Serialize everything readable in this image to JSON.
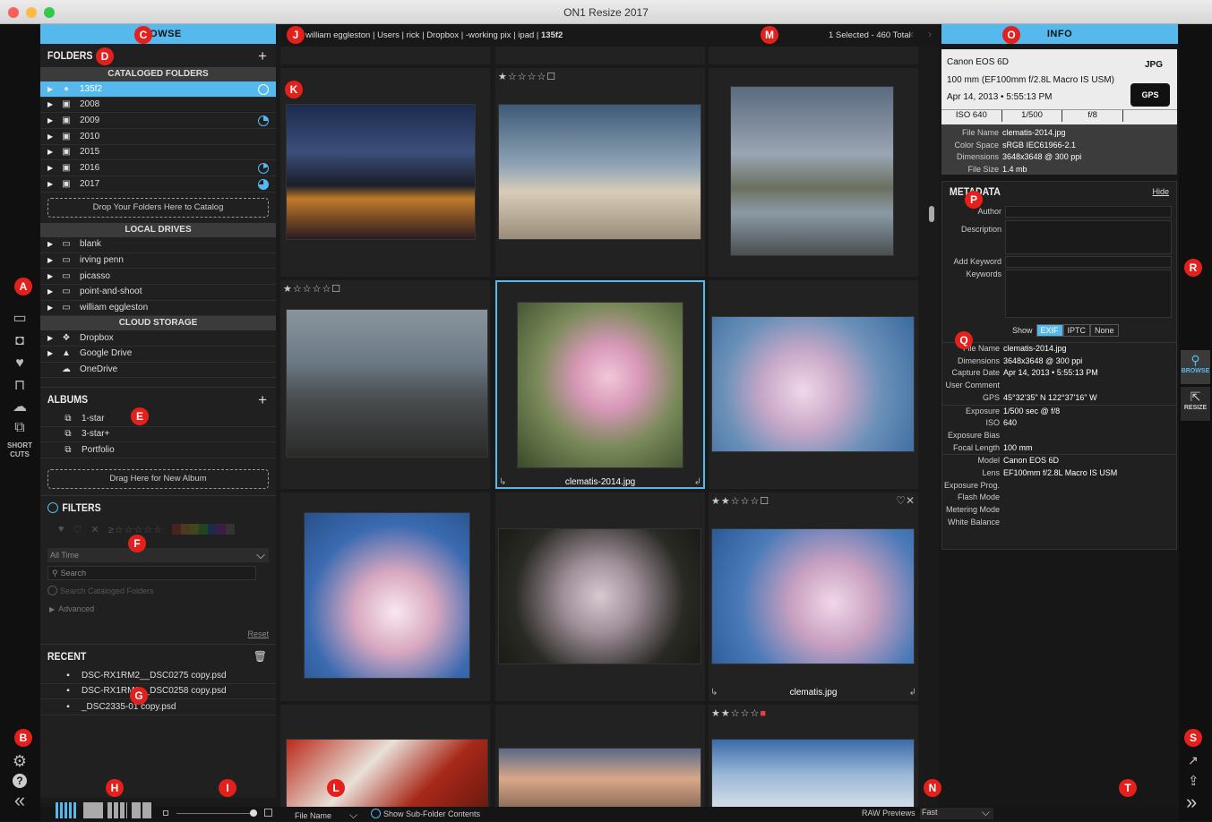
{
  "window": {
    "title": "ON1 Resize 2017"
  },
  "markers": [
    "A",
    "B",
    "C",
    "D",
    "E",
    "F",
    "G",
    "H",
    "I",
    "J",
    "K",
    "L",
    "M",
    "N",
    "O",
    "P",
    "Q",
    "R",
    "S",
    "T"
  ],
  "left_rail": {
    "shortcuts_label": "SHORT CUTS"
  },
  "browse": {
    "header": "BROWSE"
  },
  "folders": {
    "title": "FOLDERS",
    "cataloged_header": "CATALOGED FOLDERS",
    "cataloged": [
      "135f2",
      "2008",
      "2009",
      "2010",
      "2015",
      "2016",
      "2017"
    ],
    "drop_label": "Drop Your Folders Here to Catalog",
    "local_header": "LOCAL DRIVES",
    "local": [
      "blank",
      "irving penn",
      "picasso",
      "point-and-shoot",
      "william eggleston"
    ],
    "cloud_header": "CLOUD STORAGE",
    "cloud": [
      "Dropbox",
      "Google Drive",
      "OneDrive"
    ]
  },
  "albums": {
    "title": "ALBUMS",
    "items": [
      "1-star",
      "3-star+",
      "Portfolio"
    ],
    "drop_label": "Drag Here for New Album"
  },
  "filters": {
    "title": "FILTERS",
    "time": "All Time",
    "search_placeholder": "Search",
    "search_cataloged": "Search Cataloged Folders",
    "advanced": "Advanced",
    "reset": "Reset"
  },
  "recent": {
    "title": "RECENT",
    "items": [
      "DSC-RX1RM2__DSC0275 copy.psd",
      "DSC-RX1RM2__DSC0258 copy.psd",
      "_DSC2335-01 copy.psd"
    ]
  },
  "breadcrumb": {
    "path": [
      "william eggleston",
      "Users",
      "rick",
      "Dropbox",
      "-working pix",
      "ipad",
      "135f2"
    ],
    "selection": "1 Selected - 460 Total"
  },
  "grid": {
    "selected_name": "clematis-2014.jpg",
    "other_name": "clematis.jpg"
  },
  "bottom": {
    "sort": "File Name",
    "subfolder_label": "Show Sub-Folder Contents",
    "raw_label": "RAW Previews",
    "raw_value": "Fast"
  },
  "info": {
    "header": "INFO",
    "camera": "Canon EOS 6D",
    "format": "JPG",
    "lens": "100 mm (EF100mm f/2.8L Macro IS USM)",
    "date": "Apr 14, 2013 • 5:55:13 PM",
    "gps_label": "GPS",
    "iso": "ISO 640",
    "shutter": "1/500",
    "aperture": "f/8",
    "file_name_label": "File Name",
    "file_name": "clematis-2014.jpg",
    "color_space_label": "Color Space",
    "color_space": "sRGB IEC61966-2.1",
    "dimensions_label": "Dimensions",
    "dimensions": "3648x3648 @ 300 ppi",
    "file_size_label": "File Size",
    "file_size": "1.4 mb"
  },
  "metadata": {
    "title": "METADATA",
    "hide": "Hide",
    "author": "Author",
    "description": "Description",
    "add_keyword": "Add Keyword",
    "keywords": "Keywords",
    "show": "Show",
    "tabs": [
      "EXIF",
      "IPTC",
      "None"
    ],
    "exif": [
      [
        "File Name",
        "clematis-2014.jpg"
      ],
      [
        "Dimensions",
        "3648x3648 @ 300 ppi"
      ],
      [
        "Capture Date",
        "Apr 14, 2013 • 5:55:13 PM"
      ],
      [
        "User Comment",
        ""
      ],
      [
        "GPS",
        "45°32'35\" N 122°37'16\" W"
      ],
      [
        "Exposure",
        "1/500 sec @ f/8"
      ],
      [
        "ISO",
        "640"
      ],
      [
        "Exposure Bias",
        ""
      ],
      [
        "Focal Length",
        "100 mm"
      ],
      [
        "Model",
        "Canon EOS 6D"
      ],
      [
        "Lens",
        "EF100mm f/2.8L Macro IS USM"
      ],
      [
        "Exposure Prog.",
        ""
      ],
      [
        "Flash Mode",
        ""
      ],
      [
        "Metering Mode",
        ""
      ],
      [
        "White Balance",
        ""
      ]
    ]
  },
  "right_rail": {
    "browse": "BROWSE",
    "resize": "RESIZE"
  }
}
